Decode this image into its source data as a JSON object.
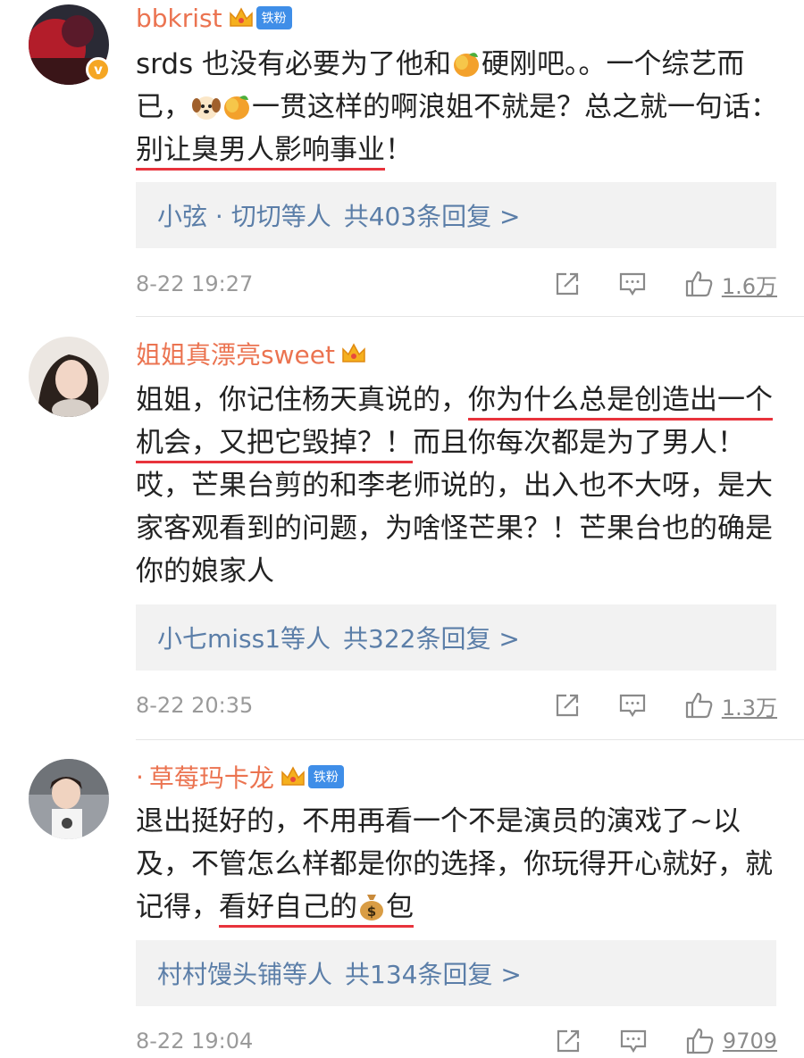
{
  "comments": [
    {
      "username": "bbkrist",
      "fan_badge": "铁粉",
      "text_parts": [
        "srds 也没有必要为了他和",
        "硬刚吧。。一个综艺而已，",
        "",
        "一贯这样的啊浪姐不就是？总之就一句话：",
        "别让臭男人影响事业",
        "！"
      ],
      "reply_users": "小弦 · 切切等人",
      "reply_count": "共403条回复 >",
      "time": "8-22 19:27",
      "likes": "1.6万"
    },
    {
      "username": "姐姐真漂亮sweet",
      "text_parts": [
        "姐姐，你记住杨天真说的，",
        "你为什么总是创造出",
        "一个机会，又把它毁掉？！",
        "而且你每次都是为了男人！哎，芒果台剪的和李老师说的，出入也不大呀，是大家客观看到的问题，为啥怪芒果？！芒果台也的确是你的娘家人"
      ],
      "reply_users": "小七miss1等人",
      "reply_count": "共322条回复 >",
      "time": "8-22 20:35",
      "likes": "1.3万"
    },
    {
      "username_dot": "·",
      "username": "草莓玛卡龙",
      "fan_badge": "铁粉",
      "text_parts": [
        "退出挺好的，不用再看一个不是演员的演戏了~以及，不管怎么样都是你的选择，你玩得开心就好，就记得，",
        "看好自己的",
        "包"
      ],
      "reply_users": "村村馒头铺等人",
      "reply_count": "共134条回复 >",
      "time": "8-22 19:04",
      "likes": "9709"
    }
  ],
  "icons": {
    "share": "share-icon",
    "comment": "comment-icon",
    "like": "thumbs-up-icon",
    "crown": "crown-icon",
    "mango": "mango-emoji",
    "dog": "dog-emoji",
    "moneybag": "money-bag-emoji"
  },
  "colors": {
    "username": "#eb7350",
    "reply_link": "#5b7ea8",
    "underline": "#e8333c",
    "fan_badge": "#3f8ee8",
    "verified": "#f5a623"
  }
}
